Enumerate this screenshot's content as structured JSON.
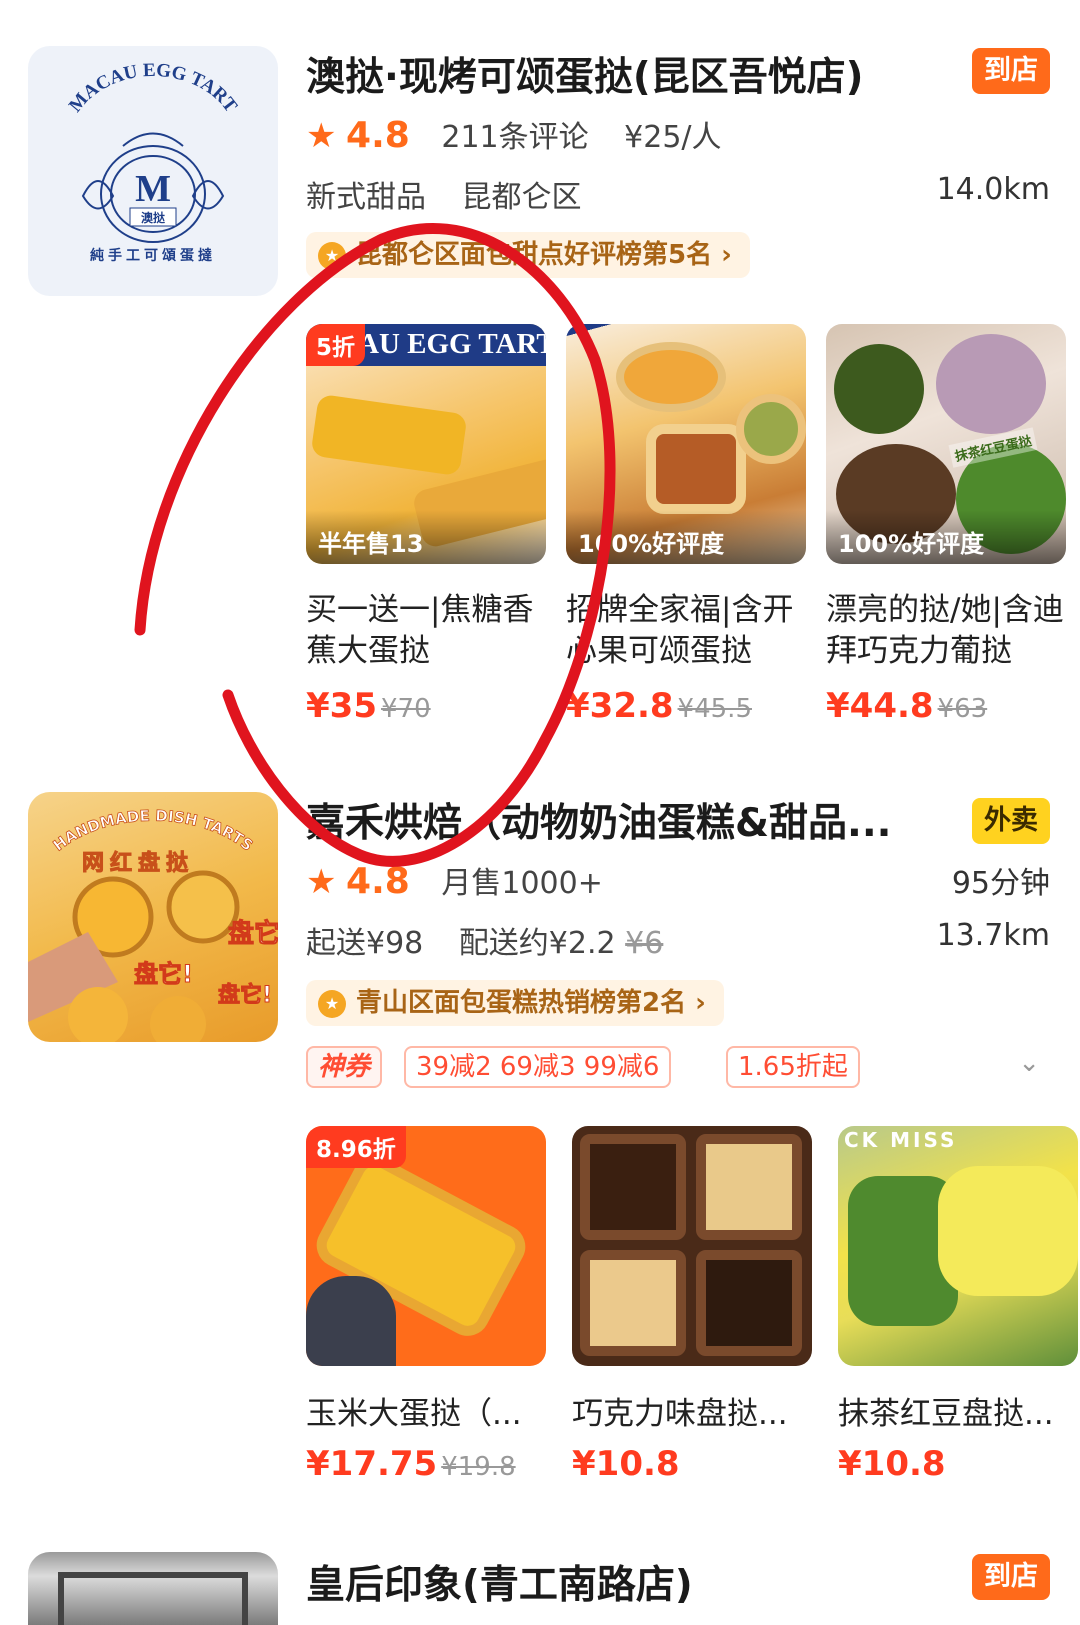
{
  "stores": [
    {
      "logo_text_top": "MACAU EGG TART",
      "logo_monogram": "M",
      "logo_sub": "澳挞",
      "logo_bottom": "純手工可頌蛋撻",
      "name": "澳挞·现烤可颂蛋挞(昆区吾悦店)",
      "tag": "到店",
      "rating": "4.8",
      "reviews": "211条评论",
      "per_person": "¥25/人",
      "category": "新式甜品",
      "district": "昆都仑区",
      "distance": "14.0km",
      "rank": "昆都仑区面包甜点好评榜第5名",
      "products": [
        {
          "badge": "5折",
          "img_banner": "AU EGG TART",
          "overlay": "半年售13",
          "name": "买一送一|焦糖香蕉大蛋挞",
          "price": "¥35",
          "old_price": "¥70"
        },
        {
          "badge": "",
          "overlay": "100%好评度",
          "name": "招牌全家福|含开心果可颂蛋挞",
          "price": "¥32.8",
          "old_price": "¥45.5"
        },
        {
          "badge": "",
          "img_banner": "抹茶红豆蛋挞",
          "overlay": "100%好评度",
          "name": "漂亮的挞/她|含迪拜巧克力葡挞",
          "price": "¥44.8",
          "old_price": "¥63"
        }
      ]
    },
    {
      "logo_text_top": "HANDMADE DISH TARTS",
      "logo_mid": "网红盘挞",
      "logo_words": [
        "盘它!",
        "盘它!",
        "盘它!"
      ],
      "name": "嘉禾烘焙（动物奶油蛋糕&甜品...",
      "tag": "外卖",
      "rating": "4.8",
      "monthly_sales": "月售1000+",
      "delivery_time": "95分钟",
      "min_order": "起送¥98",
      "delivery_fee": "配送约¥2.2",
      "delivery_fee_old": "¥6",
      "distance": "13.7km",
      "rank": "青山区面包蛋糕热销榜第2名",
      "coupons": [
        "神券",
        "39减2  69减3  99减6",
        "1.65折起"
      ],
      "products": [
        {
          "badge": "8.96折",
          "name": "玉米大蛋挞（...",
          "price": "¥17.75",
          "old_price": "¥19.8"
        },
        {
          "badge": "",
          "name": "巧克力味盘挞...",
          "price": "¥10.8",
          "old_price": ""
        },
        {
          "badge": "",
          "img_banner": "CK MISS",
          "name": "抹茶红豆盘挞...",
          "price": "¥10.8",
          "old_price": ""
        }
      ]
    },
    {
      "name": "皇后印象(青工南路店)",
      "tag": "到店"
    }
  ],
  "colors": {
    "accent": "#ff6a1a",
    "price_red": "#ff3b1f",
    "takeout_yellow": "#ffd21f",
    "rank_text": "#a86416",
    "annotation_red": "#e0141e"
  },
  "icons": [
    "star-icon",
    "medal-icon",
    "chevron-right-icon",
    "chevron-down-icon"
  ]
}
